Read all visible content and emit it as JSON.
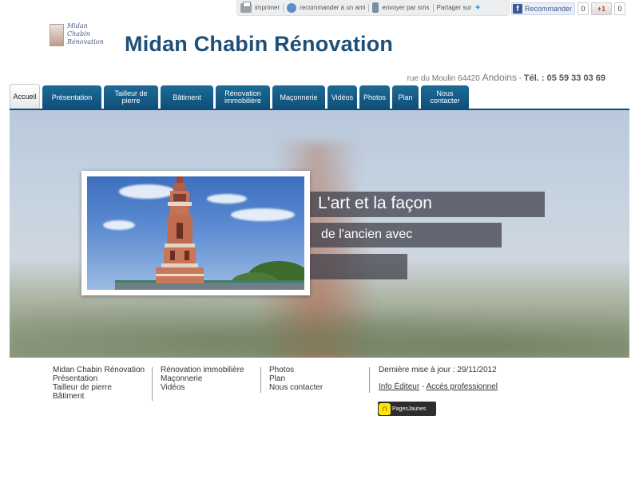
{
  "utility_bar": {
    "print_label": "imprimer",
    "recommend_label": "recommander à un ami",
    "sms_label": "envoyer par sms",
    "share_label": "Partager sur"
  },
  "social": {
    "facebook_label": "Recommander",
    "facebook_count": "0",
    "gplus_label": "+1",
    "gplus_count": "0"
  },
  "header": {
    "logo_lines": [
      "Midan",
      "Chabin",
      "Rénovation"
    ],
    "title": "Midan Chabin Rénovation",
    "address": "rue du Moulin 64420",
    "city": "Andoins",
    "tel": "Tél. : 05 59 33 03 69"
  },
  "nav": {
    "tabs": [
      {
        "label": "Accueil",
        "active": true
      },
      {
        "label": "Présentation"
      },
      {
        "label": "Tailleur de pierre"
      },
      {
        "label": "Bâtiment"
      },
      {
        "label": "Rénovation immobilière"
      },
      {
        "label": "Maçonnerie"
      },
      {
        "label": "Vidéos"
      },
      {
        "label": "Photos"
      },
      {
        "label": "Plan"
      },
      {
        "label": "Nous contacter"
      }
    ]
  },
  "banner": {
    "caption_1": "L'art et la façon",
    "caption_2": "de l'ancien avec",
    "caption_3": ""
  },
  "footer": {
    "col1": [
      "Midan Chabin Rénovation",
      "Présentation",
      "Tailleur de pierre",
      "Bâtiment"
    ],
    "col2": [
      "Rénovation immobilière",
      "Maçonnerie",
      "Vidéos"
    ],
    "col3": [
      "Photos",
      "Plan",
      "Nous contacter"
    ],
    "last_update": "Dernière mise à jour : 29/11/2012",
    "info_editeur": "Info Éditeur",
    "separator": "-",
    "acces_pro": "Accès professionnel",
    "pagesjaunes": "PagesJaunes"
  },
  "colors": {
    "brand_blue": "#1e4f78",
    "tab_blue": "#0e4e78"
  }
}
